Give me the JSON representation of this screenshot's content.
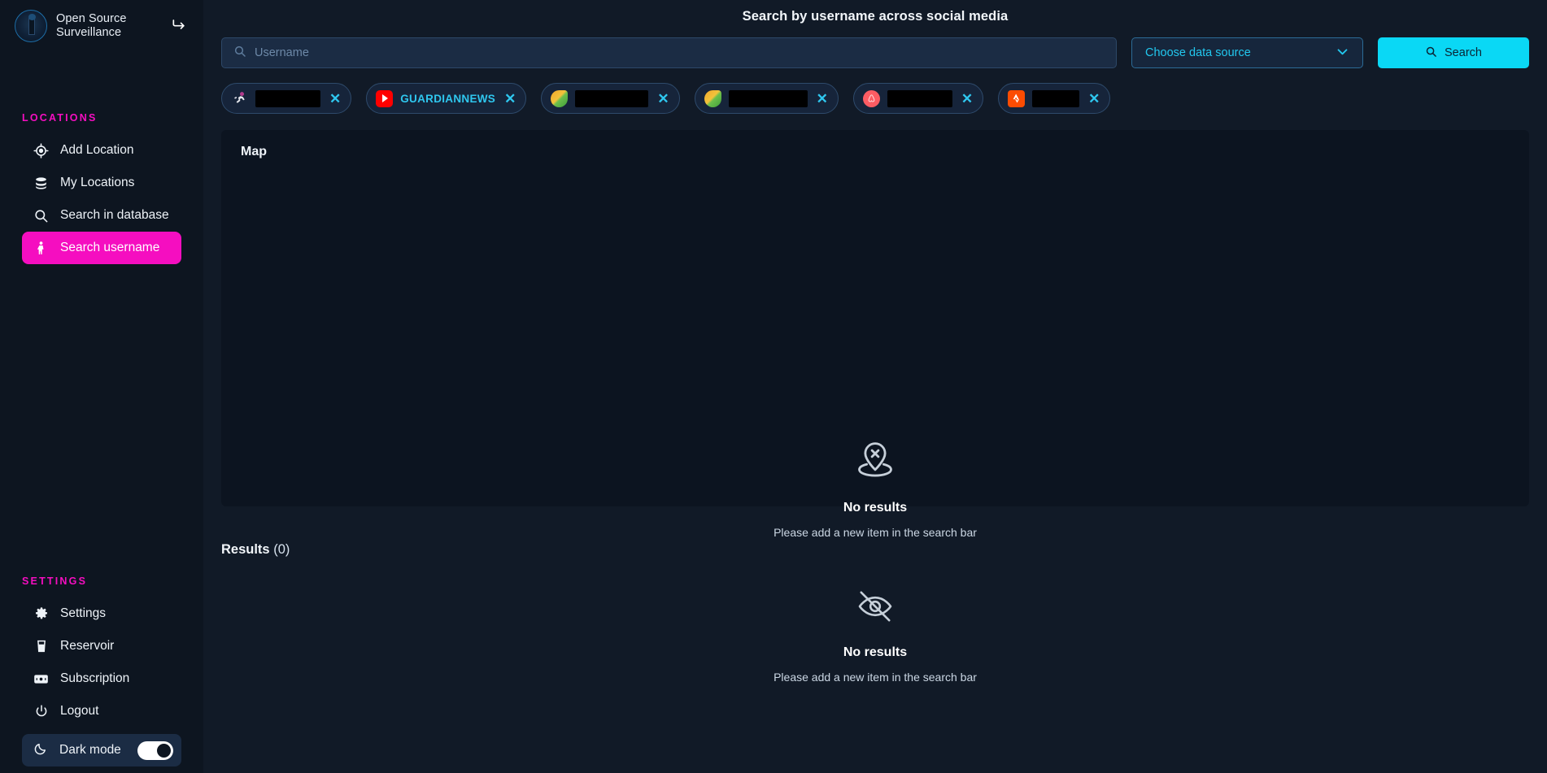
{
  "brand": {
    "name": "Open Source Surveillance",
    "collapse_icon": "collapse-arrow-icon",
    "logo_icon": "app-logo-icon"
  },
  "sidebar": {
    "locations_title": "LOCATIONS",
    "locations_items": [
      {
        "label": "Add Location",
        "icon": "crosshair-icon",
        "active": false
      },
      {
        "label": "My Locations",
        "icon": "database-icon",
        "active": false
      },
      {
        "label": "Search in database",
        "icon": "search-icon",
        "active": false
      },
      {
        "label": "Search username",
        "icon": "person-icon",
        "active": true
      }
    ],
    "settings_title": "SETTINGS",
    "settings_items": [
      {
        "label": "Settings",
        "icon": "gear-icon"
      },
      {
        "label": "Reservoir",
        "icon": "reservoir-icon"
      },
      {
        "label": "Subscription",
        "icon": "card-icon"
      },
      {
        "label": "Logout",
        "icon": "power-icon"
      }
    ],
    "dark_mode": {
      "label": "Dark mode",
      "icon": "moon-icon",
      "enabled": true
    }
  },
  "header": {
    "title": "Search by username across social media"
  },
  "search": {
    "placeholder": "Username",
    "value": "",
    "icon": "search-icon",
    "data_source_label": "Choose data source",
    "data_source_icon": "chevron-down-icon",
    "button_label": "Search",
    "button_icon": "search-icon"
  },
  "chips": [
    {
      "label": "",
      "redacted": true,
      "redacted_width": 80,
      "icon": "runner-avatar-icon",
      "close_icon": "close-icon"
    },
    {
      "label": "GUARDIANNEWS",
      "redacted": false,
      "icon": "youtube-icon",
      "close_icon": "close-icon"
    },
    {
      "label": "",
      "redacted": true,
      "redacted_width": 90,
      "icon": "leaf-icon",
      "close_icon": "close-icon"
    },
    {
      "label": "",
      "redacted": true,
      "redacted_width": 97,
      "icon": "leaf-icon",
      "close_icon": "close-icon"
    },
    {
      "label": "",
      "redacted": true,
      "redacted_width": 80,
      "icon": "airbnb-icon",
      "close_icon": "close-icon"
    },
    {
      "label": "",
      "redacted": true,
      "redacted_width": 58,
      "icon": "strava-icon",
      "close_icon": "close-icon"
    }
  ],
  "map": {
    "title": "Map",
    "empty_icon": "map-pin-off-icon",
    "empty_title": "No results",
    "empty_subtitle": "Please add a new item in the search bar"
  },
  "results": {
    "title": "Results",
    "count": "(0)",
    "empty_icon": "eye-off-icon",
    "empty_title": "No results",
    "empty_subtitle": "Please add a new item in the search bar"
  },
  "colors": {
    "accent_pink": "#f50ec0",
    "accent_cyan": "#0ad8f5",
    "chip_text": "#2fc7ef",
    "page_bg": "#111a27",
    "sidebar_bg": "#0d1520",
    "panel_bg": "#0c1420"
  }
}
